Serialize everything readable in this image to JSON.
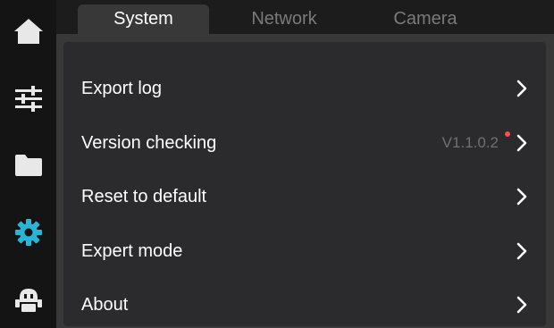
{
  "sidebar": {
    "items": [
      {
        "icon": "home-icon",
        "active": false
      },
      {
        "icon": "sliders-icon",
        "active": false
      },
      {
        "icon": "folder-icon",
        "active": false
      },
      {
        "icon": "gear-icon",
        "active": true
      },
      {
        "icon": "robot-icon",
        "active": false
      }
    ]
  },
  "tabs": {
    "system": "System",
    "network": "Network",
    "camera": "Camera",
    "active": "system"
  },
  "rows": [
    {
      "label": "Export log",
      "value": ""
    },
    {
      "label": "Version checking",
      "value": "V1.1.0.2",
      "badge": true
    },
    {
      "label": "Reset to default",
      "value": ""
    },
    {
      "label": "Expert mode",
      "value": ""
    },
    {
      "label": "About",
      "value": ""
    }
  ],
  "colors": {
    "accent": "#29b6d6",
    "icon_default": "#e8e8e8",
    "badge": "#ff4d4d"
  }
}
